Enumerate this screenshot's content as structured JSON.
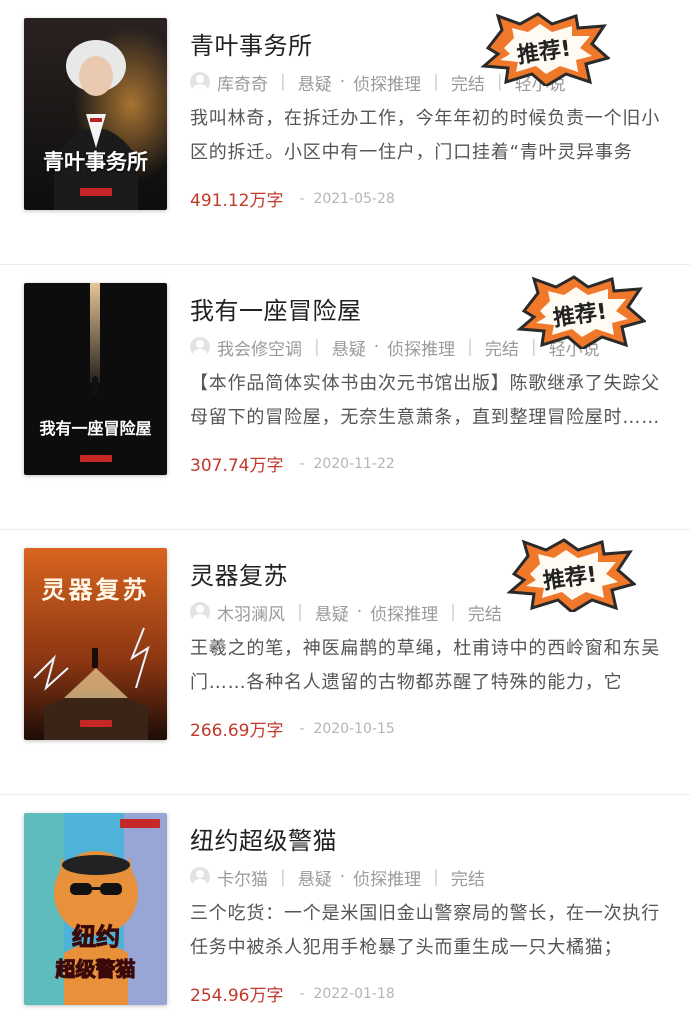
{
  "books": [
    {
      "title": "青叶事务所",
      "cover_title": "青叶事务所",
      "author": "库奇奇",
      "category": "悬疑",
      "subcategory": "侦探推理",
      "status": "完结",
      "tag": "轻小说",
      "description": "我叫林奇，在拆迁办工作，今年年初的时候负责一个旧小区的拆迁。小区中有一住户，门口挂着“青叶灵异事务所”的牌子……",
      "words": "491.12万字",
      "date": "2021-05-28",
      "badge": "推荐!",
      "cover_colors": [
        "#1a1a1a",
        "#3a2a22"
      ]
    },
    {
      "title": "我有一座冒险屋",
      "cover_title": "我有一座冒险屋",
      "author": "我会修空调",
      "category": "悬疑",
      "subcategory": "侦探推理",
      "status": "完结",
      "tag": "轻小说",
      "description": "【本作品简体实体书由次元书馆出版】陈歌继承了失踪父母留下的冒险屋，无奈生意萧条，直到整理冒险屋时……",
      "words": "307.74万字",
      "date": "2020-11-22",
      "badge": "推荐!",
      "cover_colors": [
        "#0a0a0a",
        "#2a2a2a"
      ]
    },
    {
      "title": "灵器复苏",
      "cover_title": "灵器复苏",
      "author": "木羽澜风",
      "category": "悬疑",
      "subcategory": "侦探推理",
      "status": "完结",
      "tag": "",
      "description": "王羲之的笔，神医扁鹊的草绳，杜甫诗中的西岭窗和东吴门……各种名人遗留的古物都苏醒了特殊的能力，它们……",
      "words": "266.69万字",
      "date": "2020-10-15",
      "badge": "推荐!",
      "cover_colors": [
        "#c0541a",
        "#3a1a0a"
      ]
    },
    {
      "title": "纽约超级警猫",
      "cover_title": "纽约超级警猫",
      "author": "卡尔猫",
      "category": "悬疑",
      "subcategory": "侦探推理",
      "status": "完结",
      "tag": "",
      "description": "三个吃货：一个是米国旧金山警察局的警长，在一次执行任务中被杀人犯用手枪暴了头而重生成一只大橘猫；",
      "words": "254.96万字",
      "date": "2022-01-18",
      "badge": "",
      "cover_colors": [
        "#4db3d9",
        "#e07b2a"
      ]
    }
  ],
  "colors": {
    "accent": "#c0392b",
    "badge_orange": "#f0782a"
  }
}
